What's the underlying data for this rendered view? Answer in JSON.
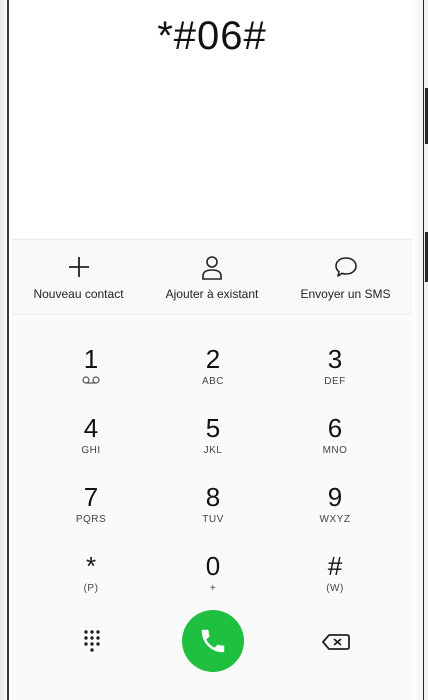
{
  "dialer": {
    "number": "*#06#"
  },
  "actions": [
    {
      "label": "Nouveau contact",
      "icon": "plus-icon"
    },
    {
      "label": "Ajouter à existant",
      "icon": "person-icon"
    },
    {
      "label": "Envoyer un SMS",
      "icon": "message-bubble-icon"
    }
  ],
  "keypad": [
    {
      "digit": "1",
      "letters": "",
      "icon": "voicemail-icon"
    },
    {
      "digit": "2",
      "letters": "ABC"
    },
    {
      "digit": "3",
      "letters": "DEF"
    },
    {
      "digit": "4",
      "letters": "GHI"
    },
    {
      "digit": "5",
      "letters": "JKL"
    },
    {
      "digit": "6",
      "letters": "MNO"
    },
    {
      "digit": "7",
      "letters": "PQRS"
    },
    {
      "digit": "8",
      "letters": "TUV"
    },
    {
      "digit": "9",
      "letters": "WXYZ"
    },
    {
      "digit": "*",
      "letters": "(P)"
    },
    {
      "digit": "0",
      "letters": "+"
    },
    {
      "digit": "#",
      "letters": "(W)"
    }
  ],
  "bottom_bar": {
    "keypad_toggle_icon": "dialpad-icon",
    "call_icon": "phone-icon",
    "delete_icon": "backspace-icon"
  },
  "colors": {
    "call_green": "#1fbf3f",
    "background": "#fafafa"
  }
}
